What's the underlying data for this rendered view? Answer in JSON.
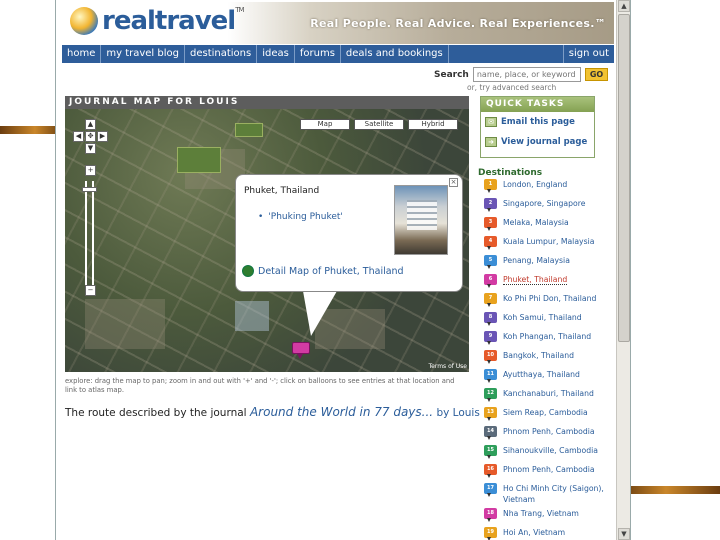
{
  "header": {
    "logo": "realtravel",
    "logo_tm": "TM",
    "tagline": "Real People. Real Advice. Real Experiences.™"
  },
  "nav": {
    "items": [
      "home",
      "my travel blog",
      "destinations",
      "ideas",
      "forums",
      "deals and bookings"
    ],
    "signout": "sign out"
  },
  "search": {
    "label": "Search",
    "placeholder": "name, place, or keyword",
    "go_label": "GO",
    "advanced": "or, try advanced search"
  },
  "journal_map": {
    "title": "JOURNAL MAP FOR LOUIS",
    "map_types": [
      "Map",
      "Satellite",
      "Hybrid"
    ],
    "terms": "Terms of Use",
    "balloon": {
      "title": "Phuket, Thailand",
      "entry": "'Phuking Phuket'",
      "detail_link": "Detail Map of Phuket, Thailand"
    },
    "explore_note": "explore: drag the map to pan; zoom in and out with '+' and '-'; click on balloons to see entries at that location and link to atlas map.",
    "route_prefix": "The route described by the journal",
    "route_journal": "Around the World in 77 days...",
    "route_by": "by Louis"
  },
  "quick_tasks": {
    "title": "QUICK TASKS",
    "items": [
      "Email this page",
      "View journal page"
    ]
  },
  "destinations": {
    "title": "Destinations",
    "items": [
      {
        "num": "1",
        "label": "London, England",
        "color": "#e8a21e"
      },
      {
        "num": "2",
        "label": "Singapore, Singapore",
        "color": "#6a55b5"
      },
      {
        "num": "3",
        "label": "Melaka, Malaysia",
        "color": "#e65a2a"
      },
      {
        "num": "4",
        "label": "Kuala Lumpur, Malaysia",
        "color": "#e65a2a"
      },
      {
        "num": "5",
        "label": "Penang, Malaysia",
        "color": "#3b8ed6"
      },
      {
        "num": "6",
        "label": "Phuket, Thailand",
        "color": "#d23ba3"
      },
      {
        "num": "7",
        "label": "Ko Phi Phi Don, Thailand",
        "color": "#e8a21e"
      },
      {
        "num": "8",
        "label": "Koh Samui, Thailand",
        "color": "#6a55b5"
      },
      {
        "num": "9",
        "label": "Koh Phangan, Thailand",
        "color": "#6a55b5"
      },
      {
        "num": "10",
        "label": "Bangkok, Thailand",
        "color": "#e65a2a"
      },
      {
        "num": "11",
        "label": "Ayutthaya, Thailand",
        "color": "#3b8ed6"
      },
      {
        "num": "12",
        "label": "Kanchanaburi, Thailand",
        "color": "#2e9e5b"
      },
      {
        "num": "13",
        "label": "Siem Reap, Cambodia",
        "color": "#e8a21e"
      },
      {
        "num": "14",
        "label": "Phnom Penh, Cambodia",
        "color": "#5b6b7b"
      },
      {
        "num": "15",
        "label": "Sihanoukville, Cambodia",
        "color": "#2e9e5b"
      },
      {
        "num": "16",
        "label": "Phnom Penh, Cambodia",
        "color": "#e65a2a"
      },
      {
        "num": "17",
        "label": "Ho Chi Minh City (Saigon), Vietnam",
        "color": "#3b8ed6"
      },
      {
        "num": "18",
        "label": "Nha Trang, Vietnam",
        "color": "#d23ba3"
      },
      {
        "num": "19",
        "label": "Hoi An, Vietnam",
        "color": "#e8a21e"
      }
    ]
  }
}
